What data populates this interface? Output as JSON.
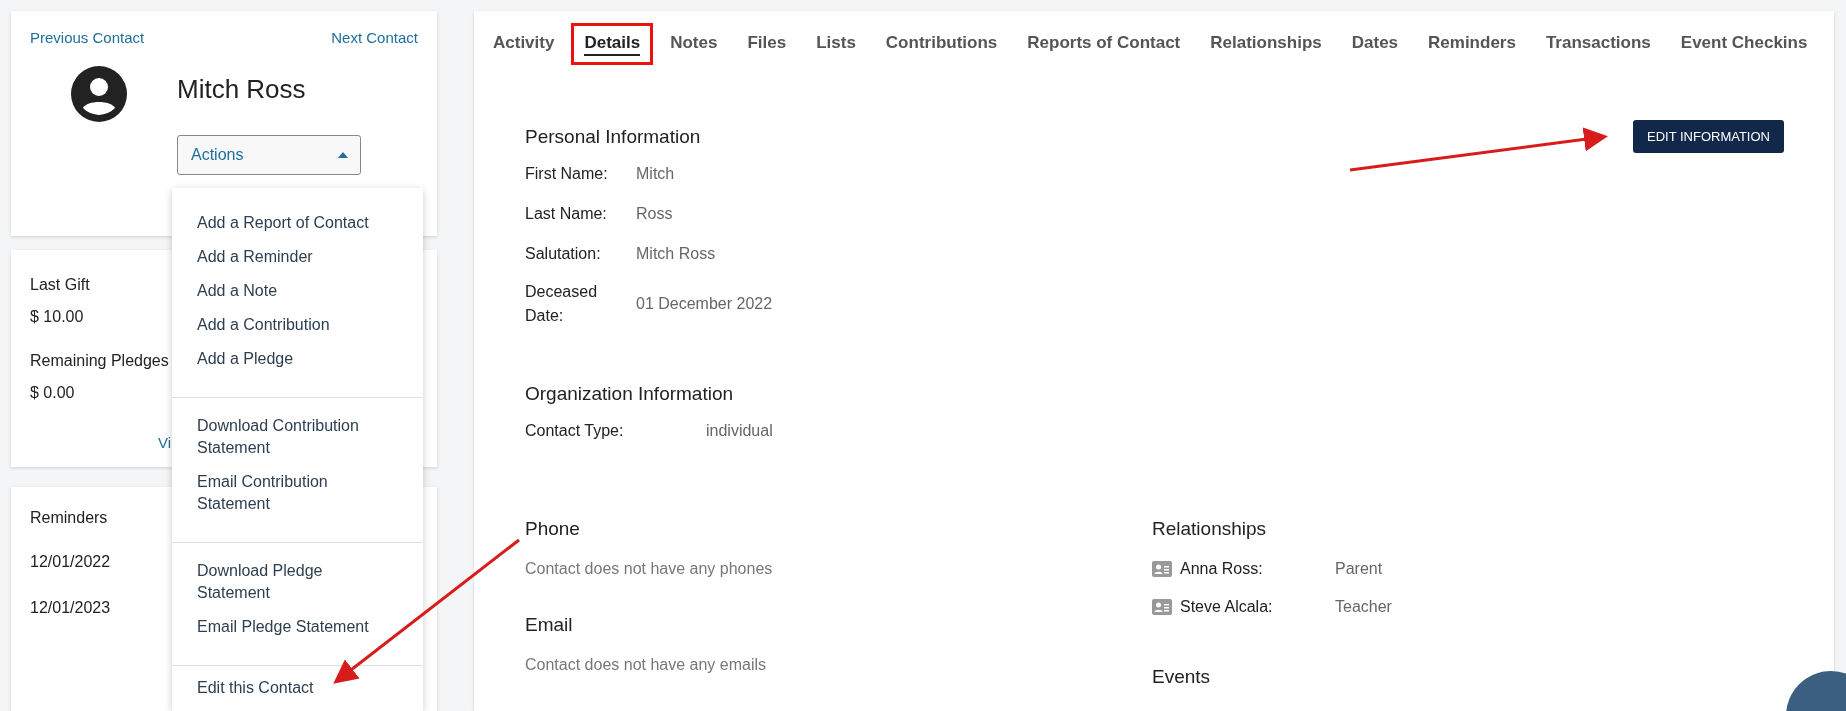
{
  "contact_nav": {
    "previous": "Previous Contact",
    "next": "Next Contact"
  },
  "contact": {
    "name": "Mitch Ross"
  },
  "actions_button": {
    "label": "Actions",
    "expanded": true
  },
  "actions_menu": {
    "groups": [
      {
        "items": [
          "Add a Report of Contact",
          "Add a Reminder",
          "Add a Note",
          "Add a Contribution",
          "Add a Pledge"
        ]
      },
      {
        "items": [
          "Download Contribution Statement",
          "Email Contribution Statement"
        ]
      },
      {
        "items": [
          "Download Pledge Statement",
          "Email Pledge Statement"
        ]
      },
      {
        "items": [
          "Edit this Contact"
        ]
      }
    ]
  },
  "gift_card": {
    "last_gift_label": "Last Gift",
    "last_gift": "$ 10.00",
    "remaining_label": "Remaining Pledges",
    "remaining": "$ 0.00",
    "link": "Vi"
  },
  "reminders_card": {
    "title": "Reminders",
    "dates": [
      "12/01/2022",
      "12/01/2023"
    ]
  },
  "tabs": [
    {
      "label": "Activity",
      "selected": false,
      "annotated": false
    },
    {
      "label": "Details",
      "selected": true,
      "annotated": true
    },
    {
      "label": "Notes",
      "selected": false,
      "annotated": false
    },
    {
      "label": "Files",
      "selected": false,
      "annotated": false
    },
    {
      "label": "Lists",
      "selected": false,
      "annotated": false
    },
    {
      "label": "Contributions",
      "selected": false,
      "annotated": false
    },
    {
      "label": "Reports of Contact",
      "selected": false,
      "annotated": false
    },
    {
      "label": "Relationships",
      "selected": false,
      "annotated": false
    },
    {
      "label": "Dates",
      "selected": false,
      "annotated": false
    },
    {
      "label": "Reminders",
      "selected": false,
      "annotated": false
    },
    {
      "label": "Transactions",
      "selected": false,
      "annotated": false
    },
    {
      "label": "Event Checkins",
      "selected": false,
      "annotated": false
    }
  ],
  "edit_button": "EDIT INFORMATION",
  "personal": {
    "title": "Personal Information",
    "fields": [
      {
        "label": "First Name:",
        "value": "Mitch"
      },
      {
        "label": "Last Name:",
        "value": "Ross"
      },
      {
        "label": "Salutation:",
        "value": "Mitch Ross"
      },
      {
        "label": "Deceased Date:",
        "value": "01 December 2022"
      }
    ]
  },
  "organization": {
    "title": "Organization Information",
    "fields": [
      {
        "label": "Contact Type:",
        "value": "individual"
      }
    ]
  },
  "phone": {
    "title": "Phone",
    "empty": "Contact does not have any phones"
  },
  "email": {
    "title": "Email",
    "empty": "Contact does not have any emails"
  },
  "relationships": {
    "title": "Relationships",
    "items": [
      {
        "name": "Anna Ross:",
        "role": "Parent"
      },
      {
        "name": "Steve Alcala:",
        "role": "Teacher"
      }
    ]
  },
  "events": {
    "title": "Events"
  }
}
